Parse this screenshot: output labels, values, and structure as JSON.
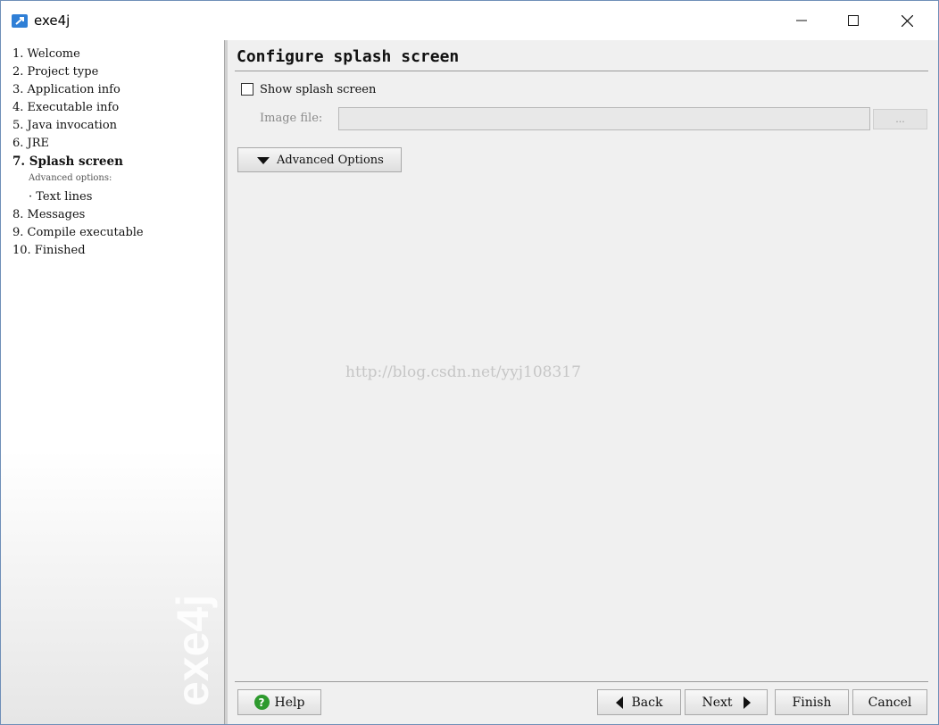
{
  "window": {
    "title": "exe4j"
  },
  "steps": [
    {
      "label": "1. Welcome"
    },
    {
      "label": "2. Project type"
    },
    {
      "label": "3. Application info"
    },
    {
      "label": "4. Executable info"
    },
    {
      "label": "5. Java invocation"
    },
    {
      "label": "6. JRE"
    },
    {
      "label": "7. Splash screen",
      "active": true
    },
    {
      "label": "8. Messages"
    },
    {
      "label": "9. Compile executable"
    },
    {
      "label": "10. Finished"
    }
  ],
  "advanced": {
    "label": "Advanced options:",
    "item": "· Text lines"
  },
  "sidebar_logo": "exe4j",
  "main": {
    "title": "Configure splash screen",
    "show_splash_label": "Show splash screen",
    "show_splash_checked": false,
    "image_file_label": "Image file:",
    "image_file_value": "",
    "browse_label": "...",
    "advanced_options_label": "Advanced Options",
    "watermark": "http://blog.csdn.net/yyj108317"
  },
  "buttons": {
    "help": "Help",
    "back": "Back",
    "next": "Next",
    "finish": "Finish",
    "cancel": "Cancel"
  },
  "colors": {
    "accent": "#2f7fd6",
    "help_icon": "#2e9a2e"
  }
}
